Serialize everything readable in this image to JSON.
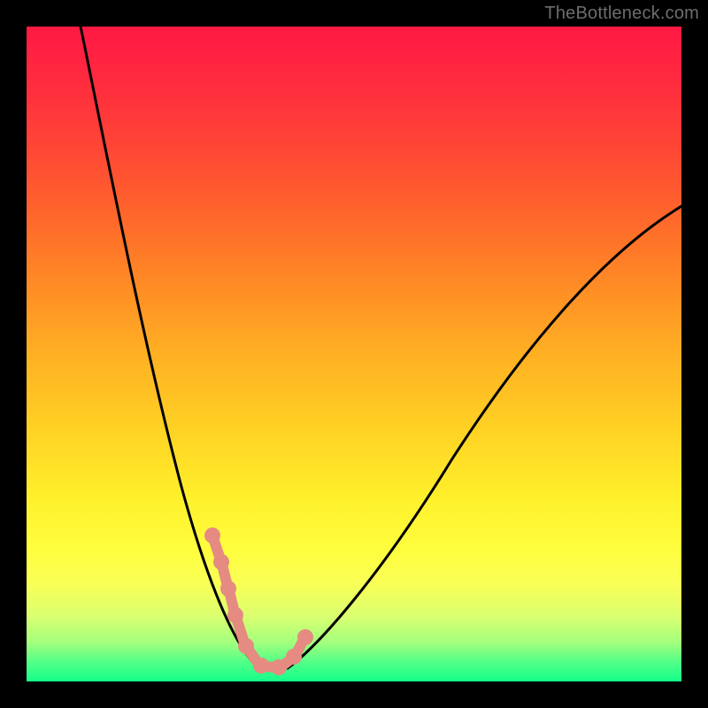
{
  "watermark": "TheBottleneck.com",
  "chart_data": {
    "type": "line",
    "title": "",
    "xlabel": "",
    "ylabel": "",
    "xlim": [
      0,
      100
    ],
    "ylim": [
      0,
      100
    ],
    "grid": false,
    "legend": false,
    "gradient_stops": [
      {
        "pos": 0,
        "color": "#ff1943"
      },
      {
        "pos": 18,
        "color": "#ff4436"
      },
      {
        "pos": 40,
        "color": "#ff8d25"
      },
      {
        "pos": 62,
        "color": "#ffd324"
      },
      {
        "pos": 80,
        "color": "#fffe3e"
      },
      {
        "pos": 94,
        "color": "#a4ff7d"
      },
      {
        "pos": 100,
        "color": "#11ff8a"
      }
    ],
    "series": [
      {
        "name": "v-curve",
        "stroke": "#000000",
        "x": [
          8,
          10,
          12,
          14,
          16,
          18,
          20,
          22,
          25,
          27,
          29,
          31,
          33,
          35,
          36,
          37,
          38,
          40,
          42,
          45,
          50,
          55,
          60,
          65,
          70,
          75,
          80,
          85,
          90,
          95,
          100
        ],
        "y_value": [
          100,
          90,
          81,
          72,
          64,
          56,
          48,
          41,
          33,
          27,
          22,
          17,
          12,
          8,
          5,
          3,
          2,
          2,
          3,
          6,
          11,
          17,
          23,
          29,
          35,
          41,
          46,
          51,
          56,
          60,
          64
        ]
      },
      {
        "name": "markers",
        "type": "scatter",
        "stroke": "#e58b81",
        "fill": "#e58b81",
        "x": [
          29,
          30.5,
          31.5,
          33,
          35,
          37,
          38.5,
          40.5,
          42
        ],
        "y_value": [
          22,
          18,
          15,
          12,
          7,
          3,
          3,
          6,
          9
        ]
      }
    ],
    "notes": "V-shaped bottleneck curve over a red→green vertical gradient. Minimum (≈0% bottleneck) occurs near x≈37-40. Values estimated from pixel positions; no axis ticks or labels are visible."
  }
}
